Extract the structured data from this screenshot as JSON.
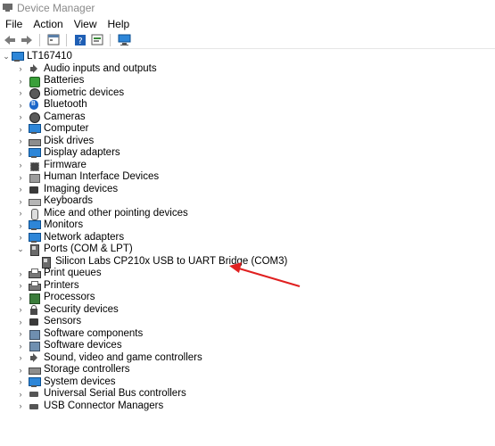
{
  "window": {
    "title": "Device Manager"
  },
  "menu": [
    "File",
    "Action",
    "View",
    "Help"
  ],
  "toolbar": {
    "buttons": [
      "back-icon",
      "forward-icon",
      "properties-icon",
      "help-icon",
      "update-driver-icon",
      "scan-hardware-icon"
    ]
  },
  "tree": {
    "root": "LT167410",
    "categories": [
      {
        "label": "Audio inputs and outputs",
        "icon": "speaker-icon"
      },
      {
        "label": "Batteries",
        "icon": "battery-icon"
      },
      {
        "label": "Biometric devices",
        "icon": "fingerprint-icon"
      },
      {
        "label": "Bluetooth",
        "icon": "bluetooth-icon"
      },
      {
        "label": "Cameras",
        "icon": "camera-icon"
      },
      {
        "label": "Computer",
        "icon": "computer-icon"
      },
      {
        "label": "Disk drives",
        "icon": "disk-drive-icon"
      },
      {
        "label": "Display adapters",
        "icon": "display-adapter-icon"
      },
      {
        "label": "Firmware",
        "icon": "firmware-icon"
      },
      {
        "label": "Human Interface Devices",
        "icon": "hid-icon"
      },
      {
        "label": "Imaging devices",
        "icon": "imaging-device-icon"
      },
      {
        "label": "Keyboards",
        "icon": "keyboard-icon"
      },
      {
        "label": "Mice and other pointing devices",
        "icon": "mouse-icon"
      },
      {
        "label": "Monitors",
        "icon": "monitor-icon"
      },
      {
        "label": "Network adapters",
        "icon": "network-adapter-icon"
      },
      {
        "label": "Ports (COM & LPT)",
        "icon": "port-icon",
        "expanded": true,
        "children": [
          {
            "label": "Silicon Labs CP210x USB to UART Bridge (COM3)",
            "icon": "port-icon"
          }
        ]
      },
      {
        "label": "Print queues",
        "icon": "printer-icon"
      },
      {
        "label": "Printers",
        "icon": "printer-icon"
      },
      {
        "label": "Processors",
        "icon": "processor-icon"
      },
      {
        "label": "Security devices",
        "icon": "security-icon"
      },
      {
        "label": "Sensors",
        "icon": "sensor-icon"
      },
      {
        "label": "Software components",
        "icon": "software-component-icon"
      },
      {
        "label": "Software devices",
        "icon": "software-device-icon"
      },
      {
        "label": "Sound, video and game controllers",
        "icon": "sound-icon"
      },
      {
        "label": "Storage controllers",
        "icon": "storage-controller-icon"
      },
      {
        "label": "System devices",
        "icon": "system-device-icon"
      },
      {
        "label": "Universal Serial Bus controllers",
        "icon": "usb-icon"
      },
      {
        "label": "USB Connector Managers",
        "icon": "usb-connector-icon"
      }
    ]
  },
  "annotation": {
    "color": "#e02020"
  }
}
